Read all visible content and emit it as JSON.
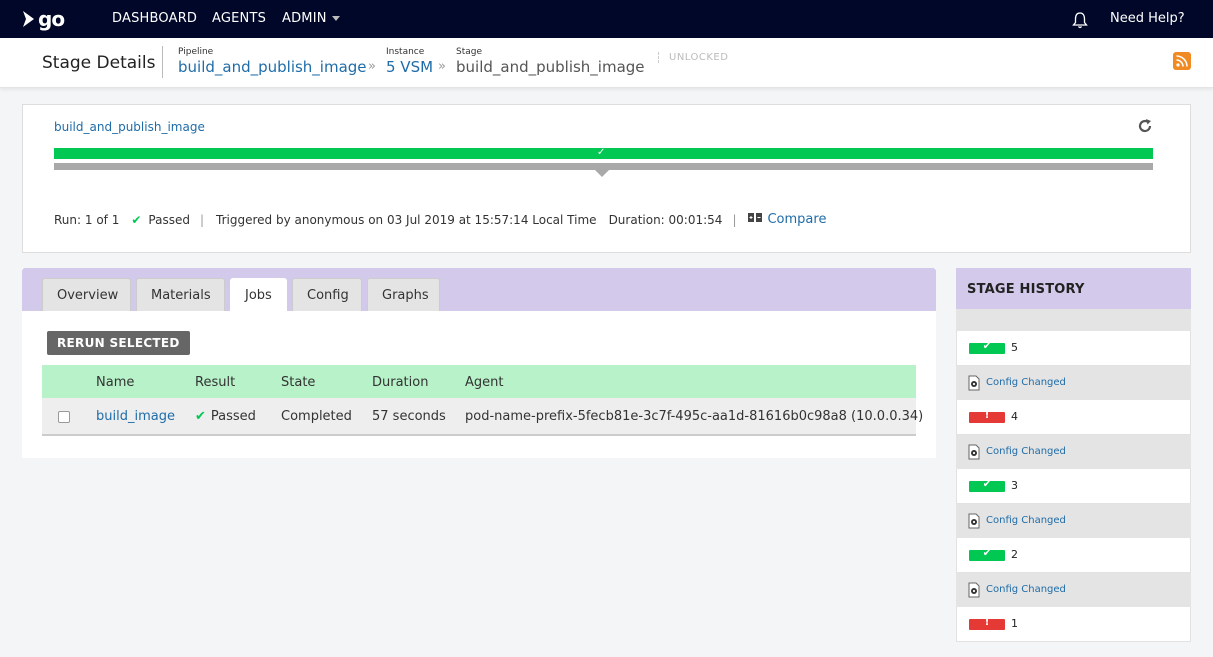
{
  "nav": {
    "logo_text": "go",
    "items": [
      "DASHBOARD",
      "AGENTS",
      "ADMIN"
    ],
    "help": "Need Help?"
  },
  "header": {
    "title": "Stage Details",
    "pipeline_label": "Pipeline",
    "pipeline_value": "build_and_publish_image",
    "instance_label": "Instance",
    "instance_value": "5 VSM",
    "stage_label": "Stage",
    "stage_value": "build_and_publish_image",
    "lock_status": "UNLOCKED"
  },
  "stage": {
    "name": "build_and_publish_image",
    "progress": 1.0,
    "run": "Run: 1 of 1",
    "result": "Passed",
    "triggered": "Triggered by anonymous on 03 Jul 2019 at 15:57:14 Local Time",
    "duration": "Duration: 00:01:54",
    "compare": "Compare"
  },
  "tabs": [
    "Overview",
    "Materials",
    "Jobs",
    "Config",
    "Graphs"
  ],
  "active_tab": "Jobs",
  "jobs": {
    "rerun_label": "RERUN SELECTED",
    "columns": [
      "Name",
      "Result",
      "State",
      "Duration",
      "Agent"
    ],
    "rows": [
      {
        "name": "build_image",
        "result": "Passed",
        "state": "Completed",
        "duration": "57 seconds",
        "agent": "pod-name-prefix-5fecb81e-3c7f-495c-aa1d-81616b0c98a8 (10.0.0.34)"
      }
    ]
  },
  "history": {
    "title": "STAGE HISTORY",
    "config_label": "Config Changed",
    "entries": [
      {
        "num": "5",
        "status": "passed"
      },
      {
        "num": "4",
        "status": "failed"
      },
      {
        "num": "3",
        "status": "passed"
      },
      {
        "num": "2",
        "status": "passed"
      },
      {
        "num": "1",
        "status": "failed"
      }
    ]
  },
  "colors": {
    "nav_bg": "#000728",
    "pass": "#00c853",
    "fail": "#e53935",
    "link": "#1f6ca8",
    "tab_bar": "#d3c9ea",
    "table_head": "#b7f2c9"
  }
}
